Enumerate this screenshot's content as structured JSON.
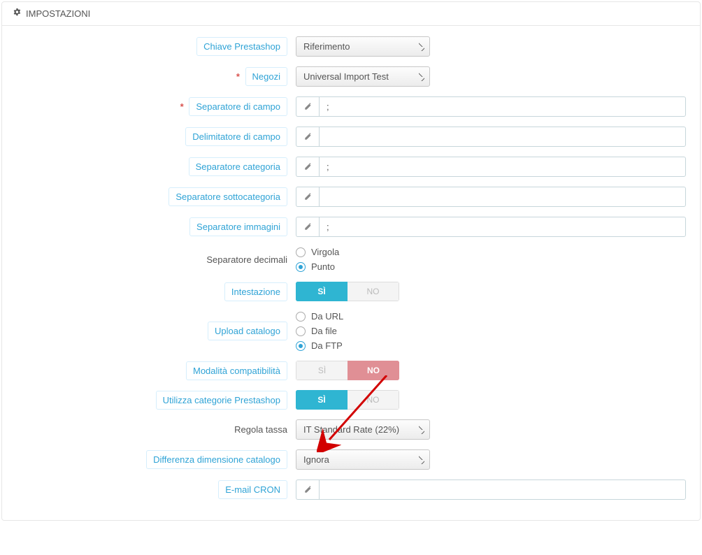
{
  "panel": {
    "title": "IMPOSTAZIONI"
  },
  "labels": {
    "chiave_prestashop": "Chiave Prestashop",
    "negozi": "Negozi",
    "sep_campo": "Separatore di campo",
    "delim_campo": "Delimitatore di campo",
    "sep_categoria": "Separatore categoria",
    "sep_sottocat": "Separatore sottocategoria",
    "sep_immagini": "Separatore immagini",
    "sep_decimali": "Separatore decimali",
    "intestazione": "Intestazione",
    "upload_catalogo": "Upload catalogo",
    "mod_compat": "Modalità compatibilità",
    "utilizza_cat": "Utilizza categorie Prestashop",
    "regola_tassa": "Regola tassa",
    "diff_dim_cat": "Differenza dimensione catalogo",
    "email_cron": "E-mail CRON"
  },
  "values": {
    "chiave_prestashop": "Riferimento",
    "negozi": "Universal Import Test",
    "sep_campo": ";",
    "delim_campo": "",
    "sep_categoria": ";",
    "sep_sottocat": "",
    "sep_immagini": ";",
    "regola_tassa": "IT Standard Rate (22%)",
    "diff_dim_cat": "Ignora",
    "email_cron": ""
  },
  "radios": {
    "decimali": {
      "virgola": "Virgola",
      "punto": "Punto"
    },
    "upload": {
      "url": "Da URL",
      "file": "Da file",
      "ftp": "Da FTP"
    }
  },
  "switch": {
    "yes": "SÌ",
    "no": "NO"
  }
}
